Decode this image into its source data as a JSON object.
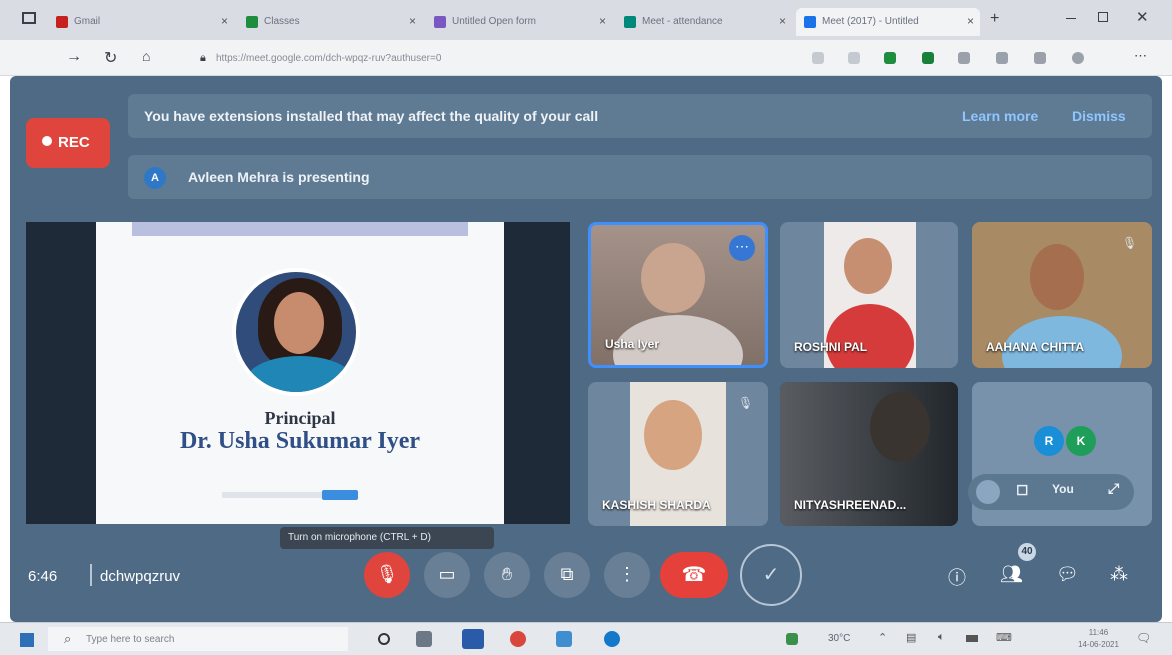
{
  "browser": {
    "tabs": [
      {
        "label": "Gmail",
        "color": "#c5221f"
      },
      {
        "label": "Classes",
        "color": "#1e8e3e"
      },
      {
        "label": "Untitled Open form",
        "color": "#7b57c2"
      },
      {
        "label": "Meet - attendance",
        "color": "#00897b"
      },
      {
        "label": "Meet (2017) - Untitled",
        "color": "#1a73e8"
      }
    ],
    "url": "https://meet.google.com/dch-wpqz-ruv?authuser=0",
    "new_tab": "+"
  },
  "meet": {
    "rec_label": "REC",
    "extension_banner": {
      "text": "You have extensions installed that may affect the quality of your call",
      "learn_more": "Learn more",
      "dismiss": "Dismiss"
    },
    "presenting_banner": {
      "avatar_letter": "A",
      "text": "Avleen Mehra is presenting"
    },
    "slide": {
      "role": "Principal",
      "name": "Dr. Usha Sukumar Iyer"
    },
    "participants": [
      {
        "name": "Usha Iyer"
      },
      {
        "name": "ROSHNI PAL"
      },
      {
        "name": "AAHANA CHITTA"
      },
      {
        "name": "KASHISH SHARDA"
      },
      {
        "name": "NITYASHREENAD..."
      }
    ],
    "overflow_tile": {
      "avatars": [
        {
          "letter": "R",
          "color": "#1a8fd8"
        },
        {
          "letter": "K",
          "color": "#1f9e5a"
        }
      ],
      "self_label": "You"
    },
    "tooltip": "Turn on microphone (CTRL + D)",
    "time": "6:46",
    "meeting_code": "dchwpqzruv",
    "people_badge": "40"
  },
  "taskbar": {
    "search_placeholder": "Type here to search",
    "temperature": "30°C",
    "clock_time": "11:46",
    "clock_date": "14-06-2021"
  }
}
